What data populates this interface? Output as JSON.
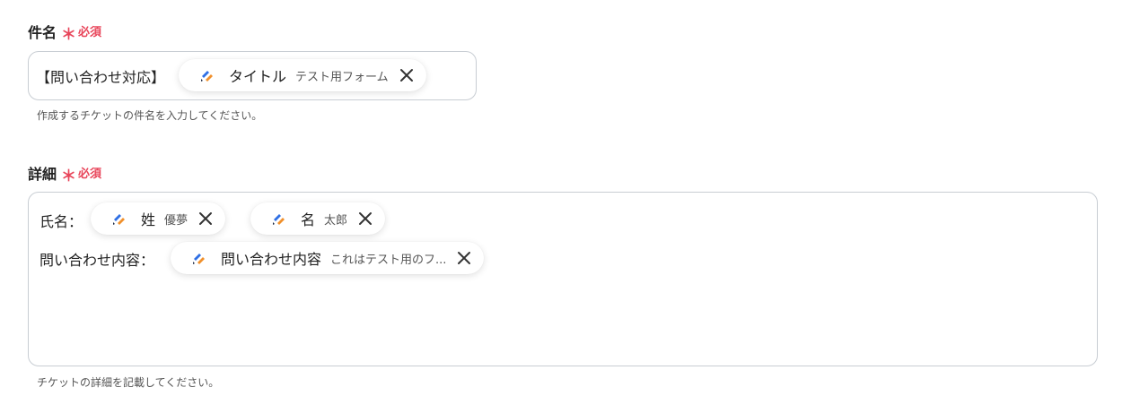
{
  "subject": {
    "label": "件名",
    "required_mark": "＊",
    "required_text": "必須",
    "prefix_text": "【問い合わせ対応】",
    "tokens": [
      {
        "name": "タイトル",
        "value": "テスト用フォーム"
      }
    ],
    "hint": "作成するチケットの件名を入力してください。"
  },
  "details": {
    "label": "詳細",
    "required_mark": "＊",
    "required_text": "必須",
    "line1_label": "氏名：",
    "line1_tokens": [
      {
        "name": "姓",
        "value": "優夢"
      },
      {
        "name": "名",
        "value": "太郎"
      }
    ],
    "line2_label": "問い合わせ内容：",
    "line2_tokens": [
      {
        "name": "問い合わせ内容",
        "value": "これはテスト用のフ..."
      }
    ],
    "hint": "チケットの詳細を記載してください。"
  },
  "colors": {
    "required": "#e8455a",
    "border": "#c8cdd3",
    "icon_blue": "#2f6fe4",
    "icon_orange": "#f0902c"
  },
  "icons": {
    "token_app": "form-app-icon",
    "remove": "close-icon"
  }
}
